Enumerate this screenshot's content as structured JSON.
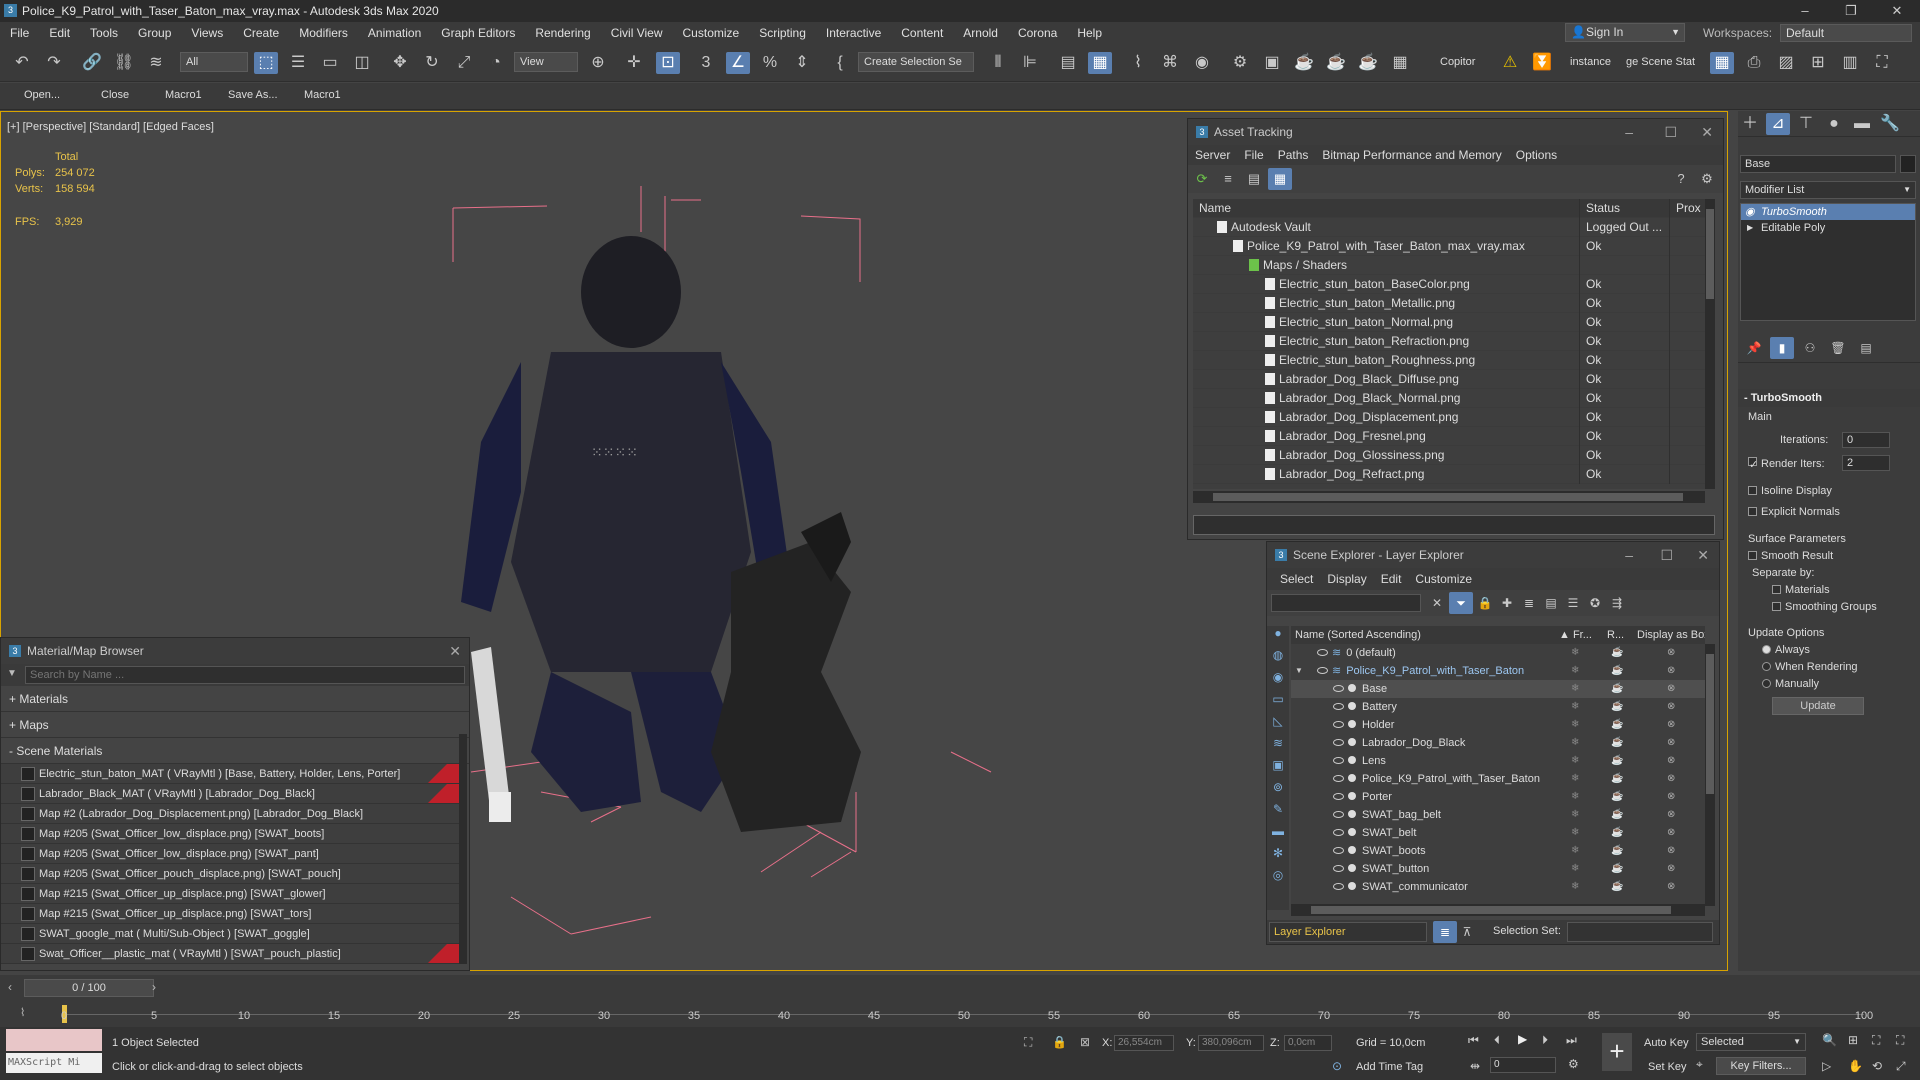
{
  "window": {
    "title": "Police_K9_Patrol_with_Taser_Baton_max_vray.max - Autodesk 3ds Max 2020"
  },
  "menu": [
    "File",
    "Edit",
    "Tools",
    "Group",
    "Views",
    "Create",
    "Modifiers",
    "Animation",
    "Graph Editors",
    "Rendering",
    "Civil View",
    "Customize",
    "Scripting",
    "Interactive",
    "Content",
    "Arnold",
    "Corona",
    "Help"
  ],
  "account": {
    "sign_in": "Sign In",
    "workspaces_label": "Workspaces:",
    "workspace_value": "Default"
  },
  "toolbar": {
    "filter": "All",
    "view": "View",
    "selection_set": "Create Selection Se",
    "copitor": "Copitor",
    "instance": "instance",
    "scene_stat": "ge Scene Stat"
  },
  "macros": [
    "Open...",
    "Close",
    "Macro1",
    "Save As...",
    "Macro1"
  ],
  "viewport": {
    "label": "[+] [Perspective] [Standard] [Edged Faces]",
    "stats_header": "Total",
    "polys_label": "Polys:",
    "polys": "254 072",
    "verts_label": "Verts:",
    "verts": "158 594",
    "fps_label": "FPS:",
    "fps": "3,929"
  },
  "asset_tracking": {
    "title": "Asset Tracking",
    "menu": [
      "Server",
      "File",
      "Paths",
      "Bitmap Performance and Memory",
      "Options"
    ],
    "col_name": "Name",
    "col_status": "Status",
    "col_proxy": "Prox",
    "rows": [
      {
        "name": "Autodesk Vault",
        "status": "Logged Out ...",
        "indent": 0
      },
      {
        "name": "Police_K9_Patrol_with_Taser_Baton_max_vray.max",
        "status": "Ok",
        "indent": 1
      },
      {
        "name": "Maps / Shaders",
        "status": "",
        "indent": 2
      },
      {
        "name": "Electric_stun_baton_BaseColor.png",
        "status": "Ok",
        "indent": 3
      },
      {
        "name": "Electric_stun_baton_Metallic.png",
        "status": "Ok",
        "indent": 3
      },
      {
        "name": "Electric_stun_baton_Normal.png",
        "status": "Ok",
        "indent": 3
      },
      {
        "name": "Electric_stun_baton_Refraction.png",
        "status": "Ok",
        "indent": 3
      },
      {
        "name": "Electric_stun_baton_Roughness.png",
        "status": "Ok",
        "indent": 3
      },
      {
        "name": "Labrador_Dog_Black_Diffuse.png",
        "status": "Ok",
        "indent": 3
      },
      {
        "name": "Labrador_Dog_Black_Normal.png",
        "status": "Ok",
        "indent": 3
      },
      {
        "name": "Labrador_Dog_Displacement.png",
        "status": "Ok",
        "indent": 3
      },
      {
        "name": "Labrador_Dog_Fresnel.png",
        "status": "Ok",
        "indent": 3
      },
      {
        "name": "Labrador_Dog_Glossiness.png",
        "status": "Ok",
        "indent": 3
      },
      {
        "name": "Labrador_Dog_Refract.png",
        "status": "Ok",
        "indent": 3
      }
    ]
  },
  "material_browser": {
    "title": "Material/Map Browser",
    "search_placeholder": "Search by Name ...",
    "cat_materials": "+ Materials",
    "cat_maps": "+ Maps",
    "cat_scene": "- Scene Materials",
    "items": [
      {
        "label": "Electric_stun_baton_MAT  ( VRayMtl )  [Base, Battery, Holder, Lens, Porter]",
        "flag": true
      },
      {
        "label": "Labrador_Black_MAT  ( VRayMtl )  [Labrador_Dog_Black]",
        "flag": true
      },
      {
        "label": "Map #2 (Labrador_Dog_Displacement.png)  [Labrador_Dog_Black]",
        "flag": false
      },
      {
        "label": "Map #205 (Swat_Officer_low_displace.png)  [SWAT_boots]",
        "flag": false
      },
      {
        "label": "Map #205 (Swat_Officer_low_displace.png)  [SWAT_pant]",
        "flag": false
      },
      {
        "label": "Map #205 (Swat_Officer_pouch_displace.png)  [SWAT_pouch]",
        "flag": false
      },
      {
        "label": "Map #215 (Swat_Officer_up_displace.png)  [SWAT_glower]",
        "flag": false
      },
      {
        "label": "Map #215 (Swat_Officer_up_displace.png)  [SWAT_tors]",
        "flag": false
      },
      {
        "label": "SWAT_google_mat  ( Multi/Sub-Object )  [SWAT_goggle]",
        "flag": false
      },
      {
        "label": "Swat_Officer__plastic_mat  ( VRayMtl )  [SWAT_pouch_plastic]",
        "flag": true
      }
    ]
  },
  "scene_explorer": {
    "title": "Scene Explorer - Layer Explorer",
    "menu": [
      "Select",
      "Display",
      "Edit",
      "Customize"
    ],
    "col_name": "Name (Sorted Ascending)",
    "col_fr": "▲ Fr...",
    "col_r": "R...",
    "col_box": "Display as Box",
    "layers": [
      {
        "name": "0 (default)",
        "level": 0
      },
      {
        "name": "Police_K9_Patrol_with_Taser_Baton",
        "level": 1
      },
      {
        "name": "Base",
        "level": 2
      },
      {
        "name": "Battery",
        "level": 2
      },
      {
        "name": "Holder",
        "level": 2
      },
      {
        "name": "Labrador_Dog_Black",
        "level": 2
      },
      {
        "name": "Lens",
        "level": 2
      },
      {
        "name": "Police_K9_Patrol_with_Taser_Baton",
        "level": 2
      },
      {
        "name": "Porter",
        "level": 2
      },
      {
        "name": "SWAT_bag_belt",
        "level": 2
      },
      {
        "name": "SWAT_belt",
        "level": 2
      },
      {
        "name": "SWAT_boots",
        "level": 2
      },
      {
        "name": "SWAT_button",
        "level": 2
      },
      {
        "name": "SWAT_communicator",
        "level": 2
      }
    ],
    "footer_explorer": "Layer Explorer",
    "footer_selset": "Selection Set:"
  },
  "command_panel": {
    "object_name": "Base",
    "modifier_list": "Modifier List",
    "stack": [
      "TurboSmooth",
      "Editable Poly"
    ],
    "rollout_title": "TurboSmooth",
    "main": "Main",
    "iterations_label": "Iterations:",
    "iterations": "0",
    "render_iters_label": "Render Iters:",
    "render_iters": "2",
    "isoline": "Isoline Display",
    "explicit": "Explicit Normals",
    "surface": "Surface Parameters",
    "smooth_result": "Smooth Result",
    "separate_by": "Separate by:",
    "materials": "Materials",
    "smoothing_groups": "Smoothing Groups",
    "update_options": "Update Options",
    "always": "Always",
    "when_rendering": "When Rendering",
    "manually": "Manually",
    "update_btn": "Update"
  },
  "timeline": {
    "frame": "0 / 100",
    "ticks": [
      "0",
      "5",
      "10",
      "15",
      "20",
      "25",
      "30",
      "35",
      "40",
      "45",
      "50",
      "55",
      "60",
      "65",
      "70",
      "75",
      "80",
      "85",
      "90",
      "95",
      "100"
    ]
  },
  "status": {
    "maxscript": "MAXScript Mi",
    "selected": "1 Object Selected",
    "hint": "Click or click-and-drag to select objects",
    "x_label": "X:",
    "x": "26,554cm",
    "y_label": "Y:",
    "y": "380,096cm",
    "z_label": "Z:",
    "z": "0,0cm",
    "grid": "Grid = 10,0cm",
    "add_time_tag": "Add Time Tag",
    "auto_key": "Auto Key",
    "set_key": "Set Key",
    "selected_combo": "Selected",
    "key_filters": "Key Filters...",
    "frame_field": "0"
  }
}
